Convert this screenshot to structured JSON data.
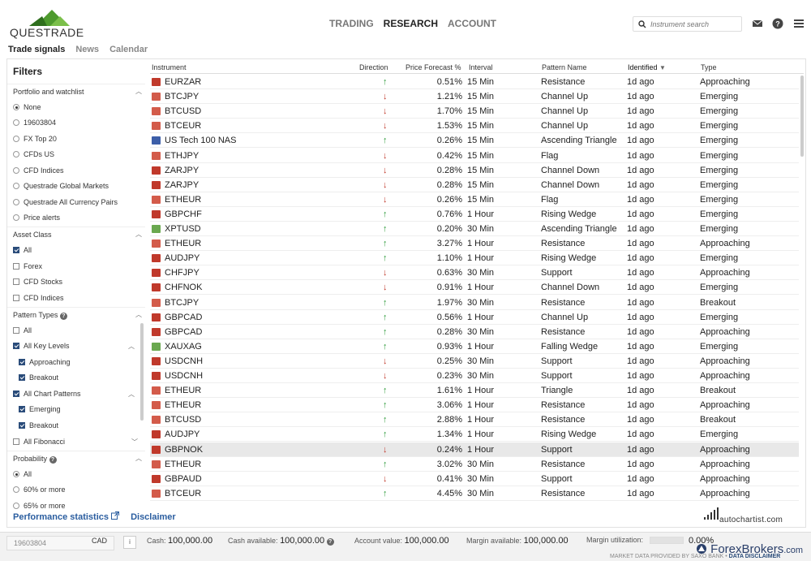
{
  "header": {
    "logo_text": "QUESTRADE",
    "nav": [
      "TRADING",
      "RESEARCH",
      "ACCOUNT"
    ],
    "active_nav": "RESEARCH",
    "search_placeholder": "Instrument search"
  },
  "subtabs": [
    "Trade signals",
    "News",
    "Calendar"
  ],
  "filters": {
    "title": "Filters",
    "portfolio": {
      "label": "Portfolio and watchlist",
      "options": [
        "None",
        "19603804",
        "FX Top 20",
        "CFDs US",
        "CFD Indices",
        "Questrade Global Markets",
        "Questrade All Currency Pairs",
        "Price alerts"
      ]
    },
    "asset_class": {
      "label": "Asset Class",
      "options": [
        "All",
        "Forex",
        "CFD Stocks",
        "CFD Indices"
      ]
    },
    "pattern_types": {
      "label": "Pattern Types",
      "options": [
        "All",
        "All Key Levels",
        "Approaching",
        "Breakout",
        "All Chart Patterns",
        "Emerging",
        "Breakout",
        "All Fibonacci"
      ]
    },
    "probability": {
      "label": "Probability",
      "options": [
        "All",
        "60% or more",
        "65% or more"
      ]
    }
  },
  "table": {
    "columns": [
      "Instrument",
      "Direction",
      "Price Forecast %",
      "Interval",
      "Pattern Name",
      "Identified",
      "Type"
    ],
    "rows": [
      {
        "icon": "fx",
        "instrument": "EURZAR",
        "dir": "up",
        "forecast": "0.51%",
        "interval": "15 Min",
        "pattern": "Resistance",
        "identified": "1d ago",
        "type": "Approaching"
      },
      {
        "icon": "cfd",
        "instrument": "BTCJPY",
        "dir": "down",
        "forecast": "1.21%",
        "interval": "15 Min",
        "pattern": "Channel Up",
        "identified": "1d ago",
        "type": "Emerging"
      },
      {
        "icon": "cfd",
        "instrument": "BTCUSD",
        "dir": "down",
        "forecast": "1.70%",
        "interval": "15 Min",
        "pattern": "Channel Up",
        "identified": "1d ago",
        "type": "Emerging"
      },
      {
        "icon": "cfd",
        "instrument": "BTCEUR",
        "dir": "down",
        "forecast": "1.53%",
        "interval": "15 Min",
        "pattern": "Channel Up",
        "identified": "1d ago",
        "type": "Emerging"
      },
      {
        "icon": "us",
        "instrument": "US Tech 100 NAS",
        "dir": "up",
        "forecast": "0.26%",
        "interval": "15 Min",
        "pattern": "Ascending Triangle",
        "identified": "1d ago",
        "type": "Emerging"
      },
      {
        "icon": "cfd",
        "instrument": "ETHJPY",
        "dir": "down",
        "forecast": "0.42%",
        "interval": "15 Min",
        "pattern": "Flag",
        "identified": "1d ago",
        "type": "Emerging"
      },
      {
        "icon": "fx",
        "instrument": "ZARJPY",
        "dir": "down",
        "forecast": "0.28%",
        "interval": "15 Min",
        "pattern": "Channel Down",
        "identified": "1d ago",
        "type": "Emerging"
      },
      {
        "icon": "fx",
        "instrument": "ZARJPY",
        "dir": "down",
        "forecast": "0.28%",
        "interval": "15 Min",
        "pattern": "Channel Down",
        "identified": "1d ago",
        "type": "Emerging"
      },
      {
        "icon": "cfd",
        "instrument": "ETHEUR",
        "dir": "down",
        "forecast": "0.26%",
        "interval": "15 Min",
        "pattern": "Flag",
        "identified": "1d ago",
        "type": "Emerging"
      },
      {
        "icon": "fx",
        "instrument": "GBPCHF",
        "dir": "up",
        "forecast": "0.76%",
        "interval": "1 Hour",
        "pattern": "Rising Wedge",
        "identified": "1d ago",
        "type": "Emerging"
      },
      {
        "icon": "com",
        "instrument": "XPTUSD",
        "dir": "up",
        "forecast": "0.20%",
        "interval": "30 Min",
        "pattern": "Ascending Triangle",
        "identified": "1d ago",
        "type": "Emerging"
      },
      {
        "icon": "cfd",
        "instrument": "ETHEUR",
        "dir": "up",
        "forecast": "3.27%",
        "interval": "1 Hour",
        "pattern": "Resistance",
        "identified": "1d ago",
        "type": "Approaching"
      },
      {
        "icon": "fx",
        "instrument": "AUDJPY",
        "dir": "up",
        "forecast": "1.10%",
        "interval": "1 Hour",
        "pattern": "Rising Wedge",
        "identified": "1d ago",
        "type": "Emerging"
      },
      {
        "icon": "fx",
        "instrument": "CHFJPY",
        "dir": "down",
        "forecast": "0.63%",
        "interval": "30 Min",
        "pattern": "Support",
        "identified": "1d ago",
        "type": "Approaching"
      },
      {
        "icon": "fx",
        "instrument": "CHFNOK",
        "dir": "down",
        "forecast": "0.91%",
        "interval": "1 Hour",
        "pattern": "Channel Down",
        "identified": "1d ago",
        "type": "Emerging"
      },
      {
        "icon": "cfd",
        "instrument": "BTCJPY",
        "dir": "up",
        "forecast": "1.97%",
        "interval": "30 Min",
        "pattern": "Resistance",
        "identified": "1d ago",
        "type": "Breakout"
      },
      {
        "icon": "fx",
        "instrument": "GBPCAD",
        "dir": "up",
        "forecast": "0.56%",
        "interval": "1 Hour",
        "pattern": "Channel Up",
        "identified": "1d ago",
        "type": "Emerging"
      },
      {
        "icon": "fx",
        "instrument": "GBPCAD",
        "dir": "up",
        "forecast": "0.28%",
        "interval": "30 Min",
        "pattern": "Resistance",
        "identified": "1d ago",
        "type": "Approaching"
      },
      {
        "icon": "com",
        "instrument": "XAUXAG",
        "dir": "up",
        "forecast": "0.93%",
        "interval": "1 Hour",
        "pattern": "Falling Wedge",
        "identified": "1d ago",
        "type": "Emerging"
      },
      {
        "icon": "fx",
        "instrument": "USDCNH",
        "dir": "down",
        "forecast": "0.25%",
        "interval": "30 Min",
        "pattern": "Support",
        "identified": "1d ago",
        "type": "Approaching"
      },
      {
        "icon": "fx",
        "instrument": "USDCNH",
        "dir": "down",
        "forecast": "0.23%",
        "interval": "30 Min",
        "pattern": "Support",
        "identified": "1d ago",
        "type": "Approaching"
      },
      {
        "icon": "cfd",
        "instrument": "ETHEUR",
        "dir": "up",
        "forecast": "1.61%",
        "interval": "1 Hour",
        "pattern": "Triangle",
        "identified": "1d ago",
        "type": "Breakout"
      },
      {
        "icon": "cfd",
        "instrument": "ETHEUR",
        "dir": "up",
        "forecast": "3.06%",
        "interval": "1 Hour",
        "pattern": "Resistance",
        "identified": "1d ago",
        "type": "Approaching"
      },
      {
        "icon": "cfd",
        "instrument": "BTCUSD",
        "dir": "up",
        "forecast": "2.88%",
        "interval": "1 Hour",
        "pattern": "Resistance",
        "identified": "1d ago",
        "type": "Breakout"
      },
      {
        "icon": "fx",
        "instrument": "AUDJPY",
        "dir": "up",
        "forecast": "1.34%",
        "interval": "1 Hour",
        "pattern": "Rising Wedge",
        "identified": "1d ago",
        "type": "Emerging"
      },
      {
        "icon": "fx",
        "instrument": "GBPNOK",
        "dir": "down",
        "forecast": "0.24%",
        "interval": "1 Hour",
        "pattern": "Support",
        "identified": "1d ago",
        "type": "Approaching"
      },
      {
        "icon": "cfd",
        "instrument": "ETHEUR",
        "dir": "up",
        "forecast": "3.02%",
        "interval": "30 Min",
        "pattern": "Resistance",
        "identified": "1d ago",
        "type": "Approaching"
      },
      {
        "icon": "fx",
        "instrument": "GBPAUD",
        "dir": "down",
        "forecast": "0.41%",
        "interval": "30 Min",
        "pattern": "Support",
        "identified": "1d ago",
        "type": "Approaching"
      },
      {
        "icon": "cfd",
        "instrument": "BTCEUR",
        "dir": "up",
        "forecast": "4.45%",
        "interval": "30 Min",
        "pattern": "Resistance",
        "identified": "1d ago",
        "type": "Approaching"
      }
    ],
    "selected_row": 25
  },
  "links": {
    "performance": "Performance statistics",
    "disclaimer": "Disclaimer"
  },
  "autochartist": "autochartist.com",
  "bottom": {
    "account": "19603804",
    "currency": "CAD",
    "info": "i",
    "cash_label": "Cash:",
    "cash": "100,000.00",
    "cash_avail_label": "Cash available:",
    "cash_avail": "100,000.00",
    "account_value_label": "Account value:",
    "account_value": "100,000.00",
    "margin_avail_label": "Margin available:",
    "margin_avail": "100,000.00",
    "margin_util_label": "Margin utilization:",
    "margin_util": "0.00%",
    "market_data": "MARKET DATA PROVIDED BY SAXO BANK",
    "data_disclaimer": "DATA DISCLAIMER"
  },
  "watermark": "ForexBrokers",
  "watermark_suffix": ".com"
}
